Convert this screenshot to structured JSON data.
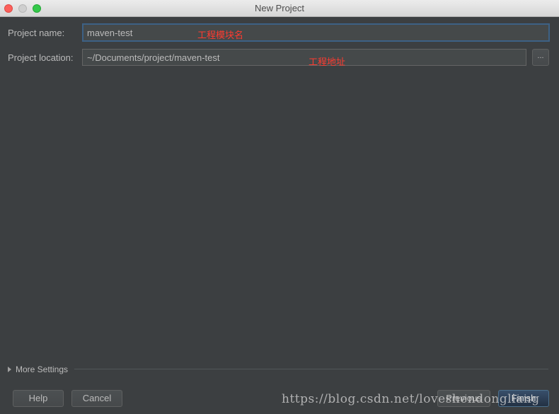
{
  "window": {
    "title": "New Project"
  },
  "form": {
    "project_name_label": "Project name:",
    "project_name_value": "maven-test",
    "project_location_label": "Project location:",
    "project_location_value": "~/Documents/project/maven-test",
    "browse_label": "..."
  },
  "annotations": {
    "name_note": "工程模块名",
    "location_note": "工程地址"
  },
  "more_settings": {
    "label": "More Settings"
  },
  "buttons": {
    "help": "Help",
    "cancel": "Cancel",
    "previous": "Previous",
    "finish": "Finish"
  },
  "watermark": "https://blog.csdn.net/loveshendongliang",
  "colors": {
    "background": "#3c3f41",
    "focus_border": "#3d6185",
    "annotation": "#ff3b30",
    "primary_button": "#2e4058"
  }
}
